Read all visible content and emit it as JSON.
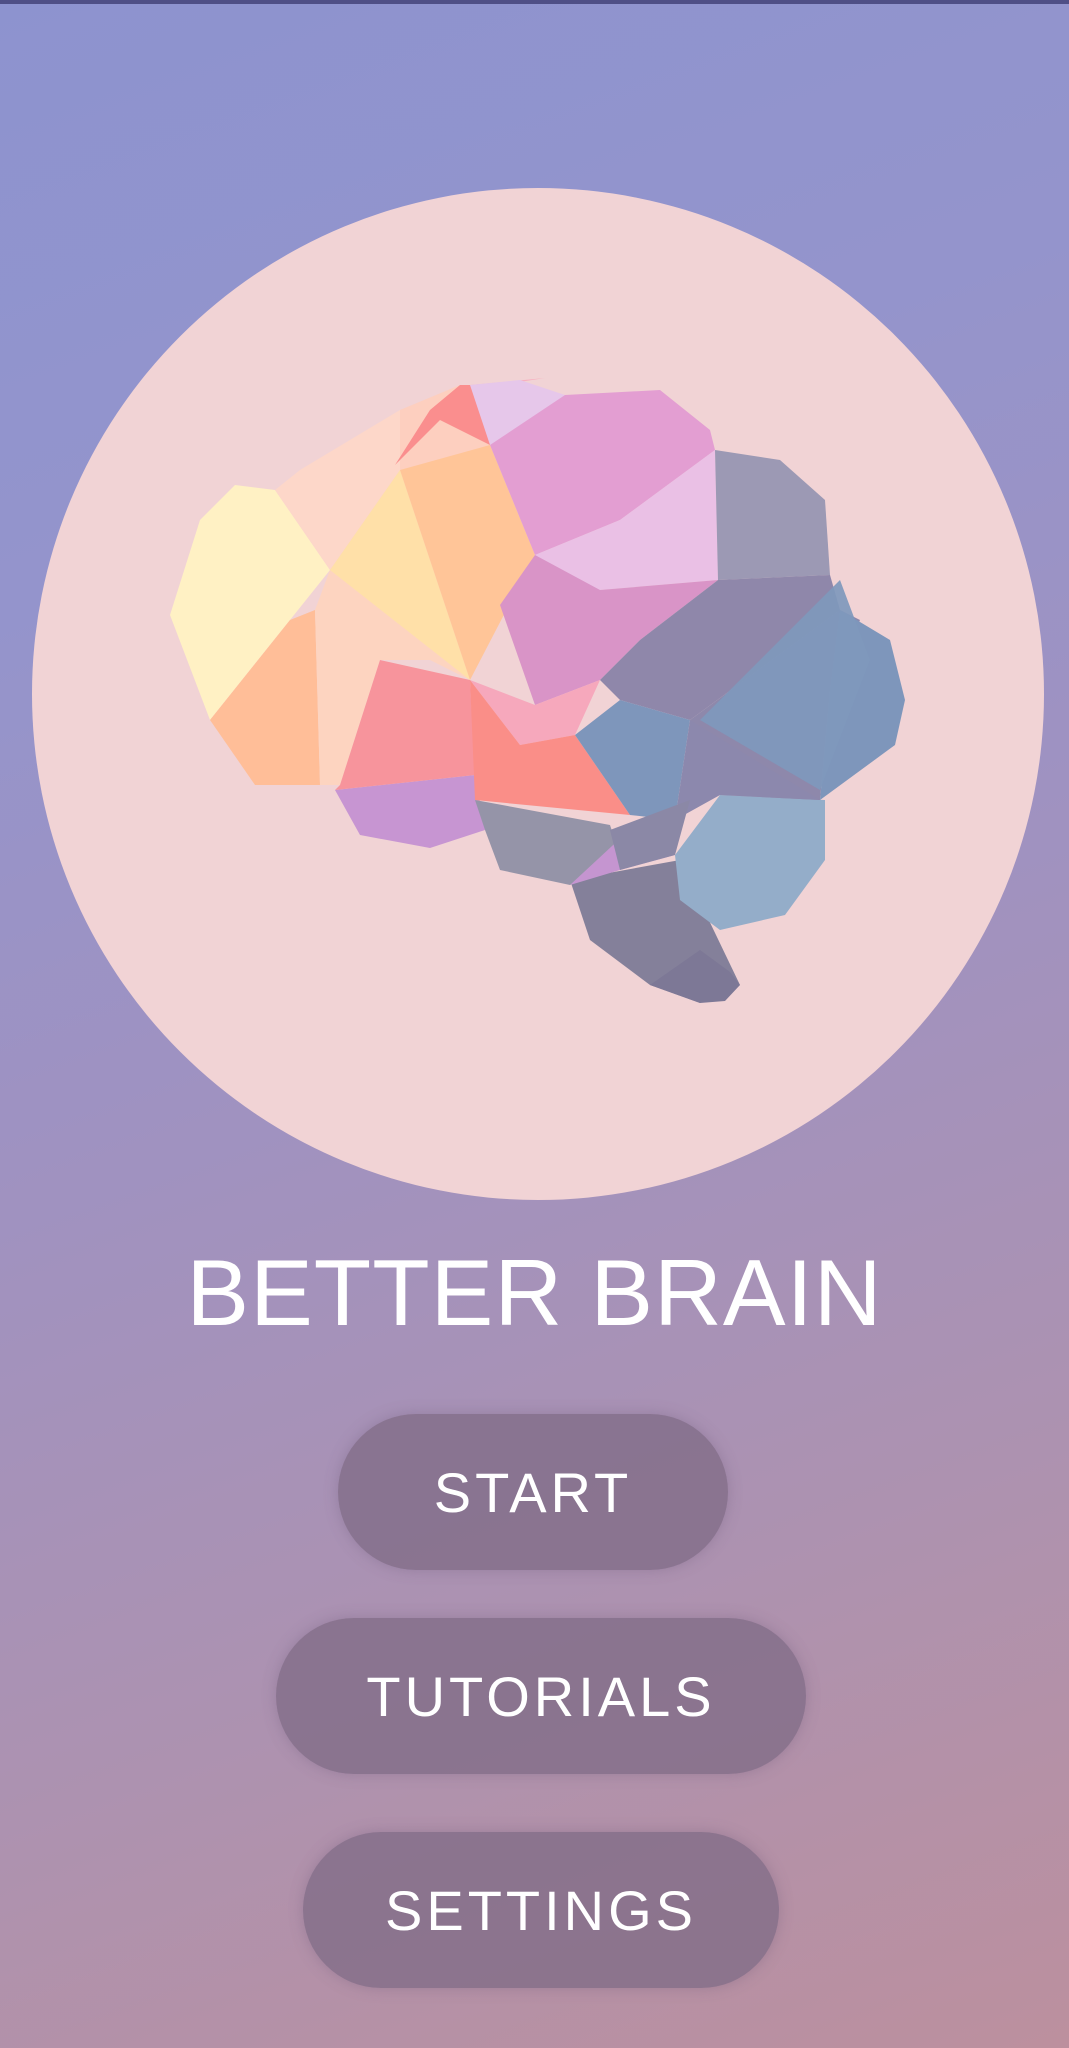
{
  "app": {
    "title": "BETTER BRAIN",
    "logo_icon": "brain-icon"
  },
  "menu": {
    "start_label": "START",
    "tutorials_label": "TUTORIALS",
    "settings_label": "SETTINGS"
  },
  "colors": {
    "circle": "#f1d3d5",
    "button": "#806c86",
    "text": "#ffffff"
  }
}
